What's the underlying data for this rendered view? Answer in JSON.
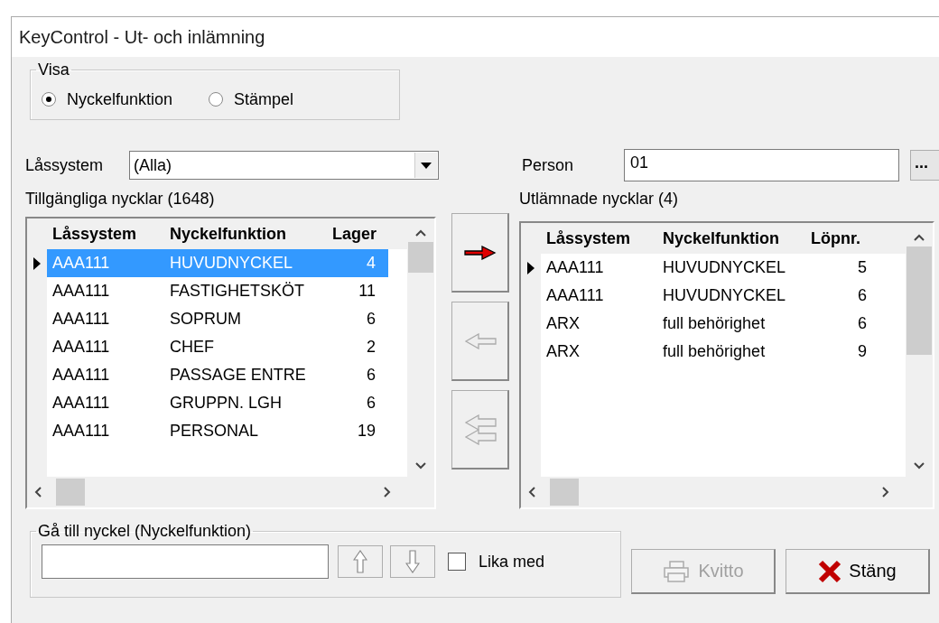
{
  "window": {
    "title": "KeyControl - Ut- och inlämning"
  },
  "view_group": {
    "title": "Visa",
    "options": [
      {
        "label": "Nyckelfunktion",
        "selected": true
      },
      {
        "label": "Stämpel",
        "selected": false
      }
    ]
  },
  "lock_system": {
    "label": "Låssystem",
    "value": "(Alla)"
  },
  "person": {
    "label": "Person",
    "value": "01",
    "browse": "..."
  },
  "available": {
    "title": "Tillgängliga nycklar (1648)",
    "columns": [
      "Låssystem",
      "Nyckelfunktion",
      "Lager"
    ],
    "rows": [
      {
        "cells": [
          "AAA111",
          "HUVUDNYCKEL",
          "4"
        ],
        "selected": true,
        "current": true
      },
      {
        "cells": [
          "AAA111",
          "FASTIGHETSKÖT",
          "11"
        ],
        "selected": false,
        "current": false
      },
      {
        "cells": [
          "AAA111",
          "SOPRUM",
          "6"
        ],
        "selected": false,
        "current": false
      },
      {
        "cells": [
          "AAA111",
          "CHEF",
          "2"
        ],
        "selected": false,
        "current": false
      },
      {
        "cells": [
          "AAA111",
          "PASSAGE ENTRE",
          "6"
        ],
        "selected": false,
        "current": false
      },
      {
        "cells": [
          "AAA111",
          "GRUPPN. LGH",
          "6"
        ],
        "selected": false,
        "current": false
      },
      {
        "cells": [
          "AAA111",
          "PERSONAL",
          "19"
        ],
        "selected": false,
        "current": false
      }
    ]
  },
  "transfer_buttons": [
    {
      "kind": "give",
      "disabled": false
    },
    {
      "kind": "return",
      "disabled": true
    },
    {
      "kind": "return_all",
      "disabled": true
    }
  ],
  "lent": {
    "title": "Utlämnade nycklar (4)",
    "columns": [
      "Låssystem",
      "Nyckelfunktion",
      "Löpnr."
    ],
    "rows": [
      {
        "cells": [
          "AAA111",
          "HUVUDNYCKEL",
          "5"
        ],
        "selected": false,
        "current": true
      },
      {
        "cells": [
          "AAA111",
          "HUVUDNYCKEL",
          "6"
        ],
        "selected": false,
        "current": false
      },
      {
        "cells": [
          "ARX",
          "full behörighet",
          "6"
        ],
        "selected": false,
        "current": false
      },
      {
        "cells": [
          "ARX",
          "full behörighet",
          "9"
        ],
        "selected": false,
        "current": false
      }
    ]
  },
  "goto_group": {
    "title": "Gå till nyckel (Nyckelfunktion)",
    "equal": {
      "label": "Lika med",
      "checked": false
    }
  },
  "buttons": [
    {
      "kind": "receipt",
      "label": "Kvitto",
      "disabled": true
    },
    {
      "kind": "close",
      "label": "Stäng",
      "disabled": false
    }
  ]
}
